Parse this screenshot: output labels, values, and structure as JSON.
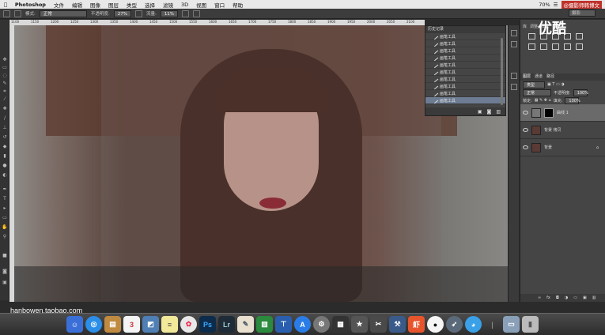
{
  "menubar": {
    "app": "Photoshop",
    "items": [
      "文件",
      "编辑",
      "图像",
      "图层",
      "类型",
      "选择",
      "滤镜",
      "3D",
      "视图",
      "窗口",
      "帮助"
    ],
    "battery": "70%",
    "brand": "@摄影师韩博文"
  },
  "options": {
    "mode_label": "模式:",
    "mode_value": "正常",
    "opacity_label": "不透明度:",
    "opacity_value": "27%",
    "flow_label": "流量:",
    "flow_value": "11%",
    "workspace": "摄影"
  },
  "ruler": [
    "1100",
    "1150",
    "1200",
    "1250",
    "1300",
    "1350",
    "1400",
    "1450",
    "1500",
    "1550",
    "1600",
    "1650",
    "1700",
    "1750",
    "1800",
    "1850",
    "1900",
    "1950",
    "2000",
    "2050",
    "2100"
  ],
  "history": {
    "title": "历史记录",
    "items": [
      "画笔工具",
      "画笔工具",
      "画笔工具",
      "画笔工具",
      "画笔工具",
      "画笔工具",
      "画笔工具",
      "画笔工具",
      "画笔工具",
      "画笔工具"
    ]
  },
  "adjustments": {
    "tabs": [
      "库",
      "调整",
      "样式"
    ]
  },
  "layers": {
    "tabs": [
      "图层",
      "通道",
      "路径"
    ],
    "kind_label": "类型",
    "blend": "正常",
    "opacity_label": "不透明度:",
    "opacity_value": "100%",
    "lock_label": "锁定:",
    "fill_label": "填充:",
    "fill_value": "100%",
    "items": [
      {
        "name": "曲线 1"
      },
      {
        "name": "背景 拷贝"
      },
      {
        "name": "背景"
      }
    ]
  },
  "watermark": "hanbowen.taobao.com",
  "overlay_logo": "优酷",
  "dock": {
    "calendar_day": "3",
    "ps": "Ps",
    "lr": "Lr",
    "xia": "虾"
  },
  "colors": {
    "accent": "#6d7c93",
    "brand": "#c0322b"
  }
}
